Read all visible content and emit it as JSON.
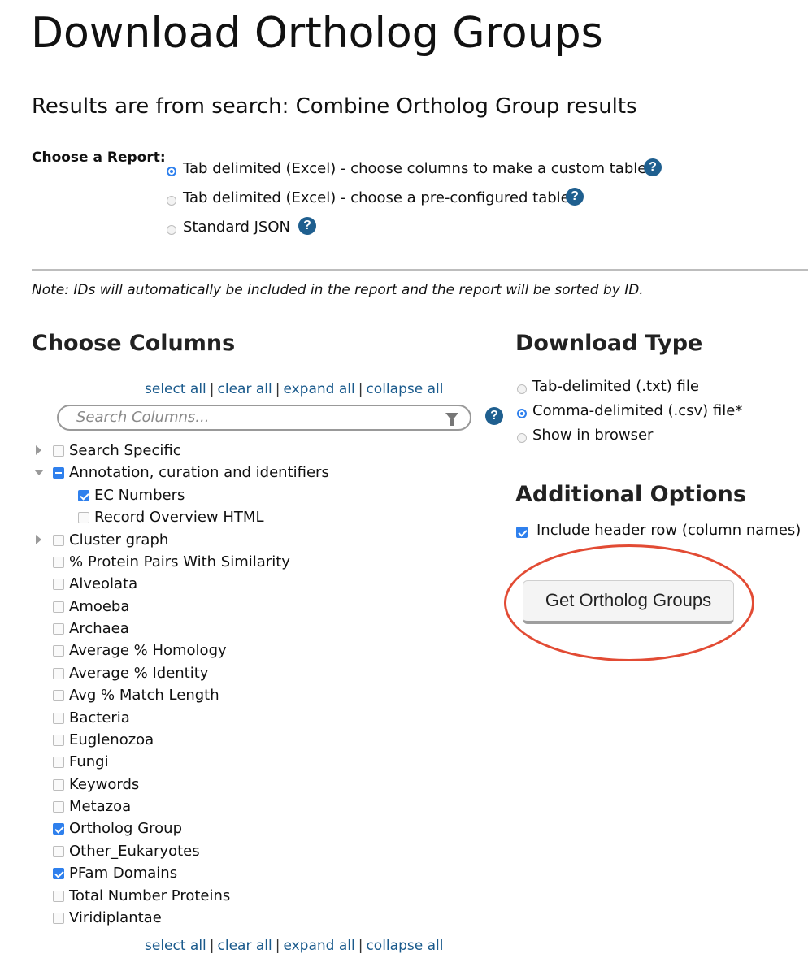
{
  "page": {
    "title": "Download Ortholog Groups",
    "subtitle": "Results are from search: Combine Ortholog Group results"
  },
  "report": {
    "label": "Choose a Report:",
    "options": [
      {
        "label": "Tab delimited (Excel) - choose columns to make a custom table",
        "checked": true
      },
      {
        "label": "Tab delimited (Excel) - choose a pre-configured table",
        "checked": false
      },
      {
        "label": "Standard JSON",
        "checked": false
      }
    ],
    "help_glyph": "?"
  },
  "note": "Note: IDs will automatically be included in the report and the report will be sorted by ID.",
  "columns": {
    "heading": "Choose Columns",
    "links": {
      "select_all": "select all",
      "clear_all": "clear all",
      "expand_all": "expand all",
      "collapse_all": "collapse all",
      "separator": "|"
    },
    "search_placeholder": "Search Columns...",
    "tree": [
      {
        "label": "Search Specific",
        "state": "unchecked",
        "expander": "collapsed",
        "level": 0
      },
      {
        "label": "Annotation, curation and identifiers",
        "state": "partial",
        "expander": "expanded",
        "level": 0
      },
      {
        "label": "EC Numbers",
        "state": "checked",
        "expander": "none",
        "level": 1
      },
      {
        "label": "Record Overview HTML",
        "state": "unchecked",
        "expander": "none",
        "level": 1
      },
      {
        "label": "Cluster graph",
        "state": "unchecked",
        "expander": "collapsed",
        "level": 0
      },
      {
        "label": "% Protein Pairs With Similarity",
        "state": "unchecked",
        "expander": "none",
        "level": 0
      },
      {
        "label": "Alveolata",
        "state": "unchecked",
        "expander": "none",
        "level": 0
      },
      {
        "label": "Amoeba",
        "state": "unchecked",
        "expander": "none",
        "level": 0
      },
      {
        "label": "Archaea",
        "state": "unchecked",
        "expander": "none",
        "level": 0
      },
      {
        "label": "Average % Homology",
        "state": "unchecked",
        "expander": "none",
        "level": 0
      },
      {
        "label": "Average % Identity",
        "state": "unchecked",
        "expander": "none",
        "level": 0
      },
      {
        "label": "Avg % Match Length",
        "state": "unchecked",
        "expander": "none",
        "level": 0
      },
      {
        "label": "Bacteria",
        "state": "unchecked",
        "expander": "none",
        "level": 0
      },
      {
        "label": "Euglenozoa",
        "state": "unchecked",
        "expander": "none",
        "level": 0
      },
      {
        "label": "Fungi",
        "state": "unchecked",
        "expander": "none",
        "level": 0
      },
      {
        "label": "Keywords",
        "state": "unchecked",
        "expander": "none",
        "level": 0
      },
      {
        "label": "Metazoa",
        "state": "unchecked",
        "expander": "none",
        "level": 0
      },
      {
        "label": "Ortholog Group",
        "state": "checked",
        "expander": "none",
        "level": 0
      },
      {
        "label": "Other_Eukaryotes",
        "state": "unchecked",
        "expander": "none",
        "level": 0
      },
      {
        "label": "PFam Domains",
        "state": "checked",
        "expander": "none",
        "level": 0
      },
      {
        "label": "Total Number Proteins",
        "state": "unchecked",
        "expander": "none",
        "level": 0
      },
      {
        "label": "Viridiplantae",
        "state": "unchecked",
        "expander": "none",
        "level": 0
      }
    ]
  },
  "download_type": {
    "heading": "Download Type",
    "options": [
      {
        "label": "Tab-delimited (.txt) file",
        "checked": false
      },
      {
        "label": "Comma-delimited (.csv) file*",
        "checked": true
      },
      {
        "label": "Show in browser",
        "checked": false
      }
    ]
  },
  "additional": {
    "heading": "Additional Options",
    "header_row_label": "Include header row (column names)",
    "header_row_checked": true
  },
  "submit_label": "Get Ortholog Groups",
  "colors": {
    "accent": "#2f80ed",
    "link": "#1a5a8c",
    "help": "#1f5f8f",
    "annotation_circle": "#e24b34"
  },
  "icons": [
    "help-icon",
    "filter-icon",
    "expand-arrow-icon",
    "collapse-arrow-icon"
  ]
}
